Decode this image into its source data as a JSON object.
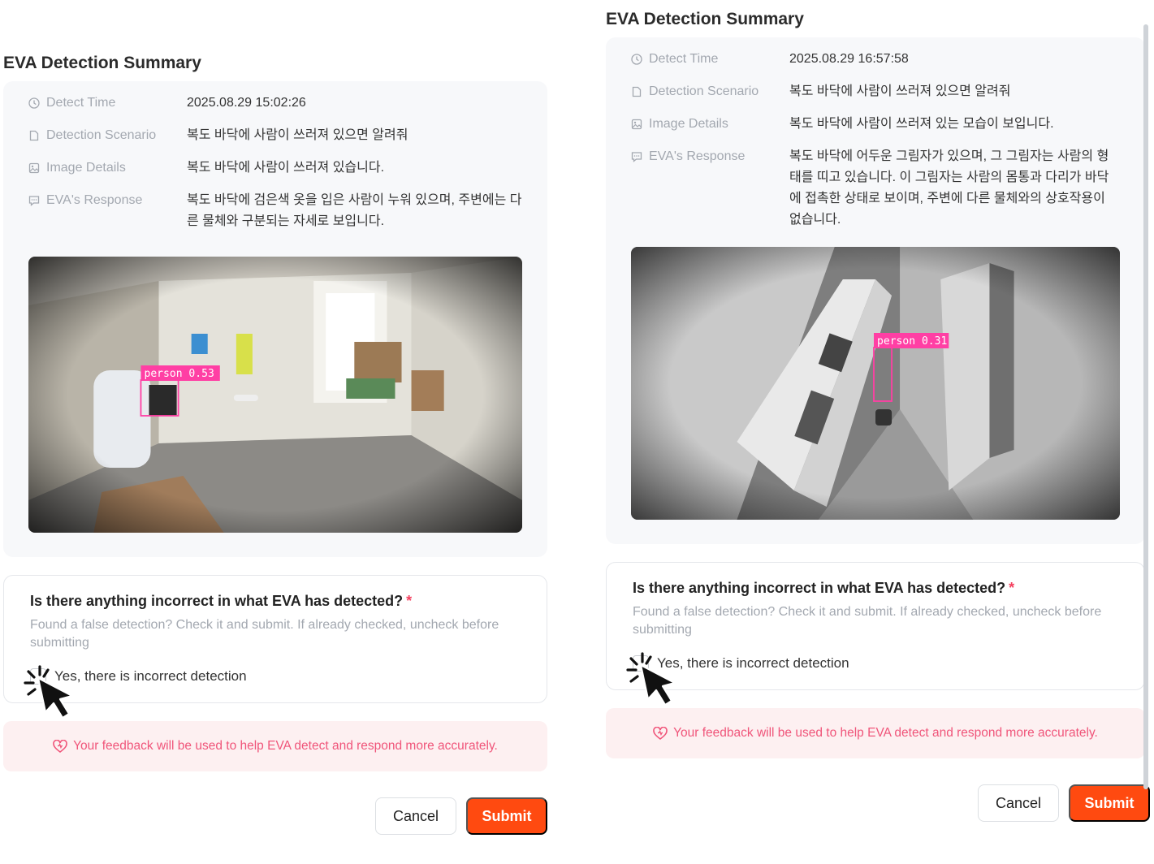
{
  "panels": [
    {
      "title": "EVA Detection Summary",
      "fields": [
        {
          "label": "Detect Time",
          "icon": "clock-icon",
          "value": "2025.08.29 15:02:26"
        },
        {
          "label": "Detection Scenario",
          "icon": "document-icon",
          "value": "복도 바닥에 사람이 쓰러져 있으면 알려줘"
        },
        {
          "label": "Image Details",
          "icon": "image-icon",
          "value": "복도 바닥에 사람이 쓰러져 있습니다."
        },
        {
          "label": "EVA's Response",
          "icon": "message-icon",
          "value": "복도 바닥에 검은색 옷을 입은 사람이 누워 있으며, 주변에는 다른 물체와 구분되는 자세로 보입니다."
        }
      ],
      "detection_label": "person 0.53",
      "question": {
        "title": "Is there anything incorrect in what EVA has detected?",
        "required_mark": "*",
        "help": "Found a false detection? Check it and submit. If already checked, uncheck before submitting",
        "option": "Yes, there is incorrect detection"
      },
      "notice": "Your feedback will be used to help EVA detect and respond more accurately.",
      "cancel_label": "Cancel",
      "submit_label": "Submit"
    },
    {
      "title": "EVA Detection Summary",
      "fields": [
        {
          "label": "Detect Time",
          "icon": "clock-icon",
          "value": "2025.08.29 16:57:58"
        },
        {
          "label": "Detection Scenario",
          "icon": "document-icon",
          "value": "복도 바닥에 사람이 쓰러져 있으면 알려줘"
        },
        {
          "label": "Image Details",
          "icon": "image-icon",
          "value": "복도 바닥에 사람이 쓰러져 있는 모습이 보입니다."
        },
        {
          "label": "EVA's Response",
          "icon": "message-icon",
          "value": "복도 바닥에 어두운 그림자가 있으며, 그 그림자는 사람의 형태를 띠고 있습니다. 이 그림자는 사람의 몸통과 다리가 바닥에 접촉한 상태로 보이며, 주변에 다른 물체와의 상호작용이 없습니다."
        }
      ],
      "detection_label": "person 0.31",
      "question": {
        "title": "Is there anything incorrect in what EVA has detected?",
        "required_mark": "*",
        "help": "Found a false detection? Check it and submit. If already checked, uncheck before submitting",
        "option": "Yes, there is incorrect detection"
      },
      "notice": "Your feedback will be used to help EVA detect and respond more accurately.",
      "cancel_label": "Cancel",
      "submit_label": "Submit"
    }
  ],
  "colors": {
    "submit": "#ff4a10",
    "required": "#f43f5e",
    "notice_text": "#f0557a",
    "notice_bg": "#fdf0f1",
    "bbox": "#ff3fa4"
  }
}
